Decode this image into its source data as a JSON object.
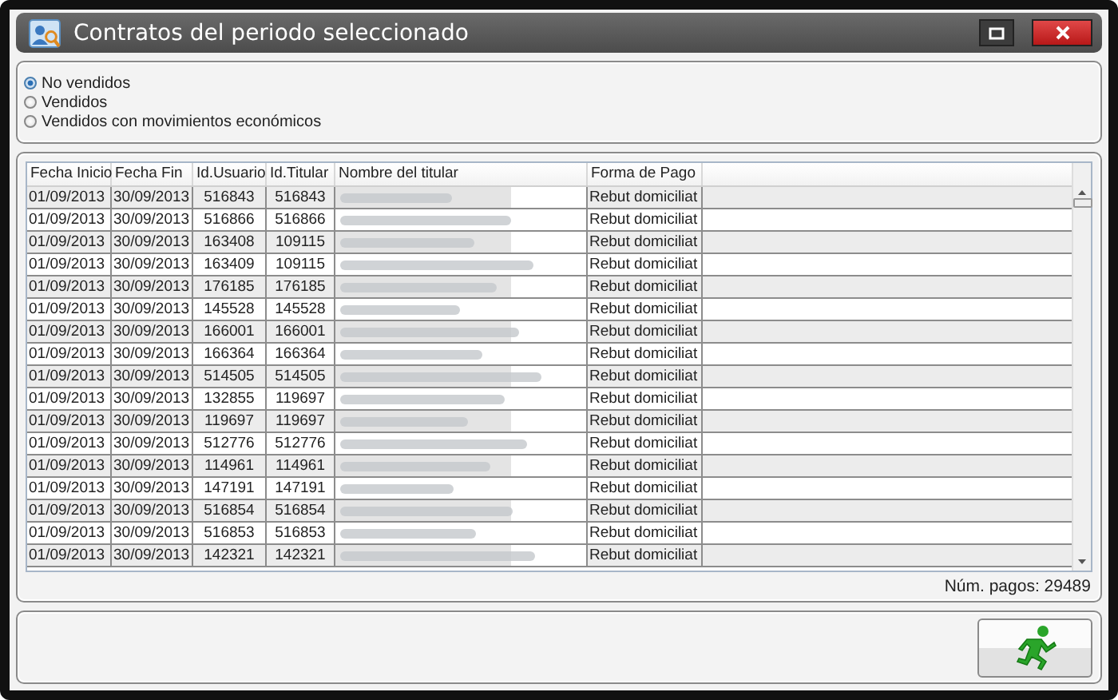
{
  "window": {
    "title": "Contratos del periodo seleccionado"
  },
  "filters": [
    {
      "label": "No vendidos",
      "selected": true
    },
    {
      "label": "Vendidos",
      "selected": false
    },
    {
      "label": "Vendidos con movimientos económicos",
      "selected": false
    }
  ],
  "table": {
    "columns": [
      "Fecha Inicio",
      "Fecha Fin",
      "Id.Usuario",
      "Id.Titular",
      "Nombre del titular",
      "Forma de Pago"
    ],
    "rows": [
      [
        "01/09/2013",
        "30/09/2013",
        "516843",
        "516843",
        "Rebut domiciliat"
      ],
      [
        "01/09/2013",
        "30/09/2013",
        "516866",
        "516866",
        "Rebut domiciliat"
      ],
      [
        "01/09/2013",
        "30/09/2013",
        "163408",
        "109115",
        "Rebut domiciliat"
      ],
      [
        "01/09/2013",
        "30/09/2013",
        "163409",
        "109115",
        "Rebut domiciliat"
      ],
      [
        "01/09/2013",
        "30/09/2013",
        "176185",
        "176185",
        "Rebut domiciliat"
      ],
      [
        "01/09/2013",
        "30/09/2013",
        "145528",
        "145528",
        "Rebut domiciliat"
      ],
      [
        "01/09/2013",
        "30/09/2013",
        "166001",
        "166001",
        "Rebut domiciliat"
      ],
      [
        "01/09/2013",
        "30/09/2013",
        "166364",
        "166364",
        "Rebut domiciliat"
      ],
      [
        "01/09/2013",
        "30/09/2013",
        "514505",
        "514505",
        "Rebut domiciliat"
      ],
      [
        "01/09/2013",
        "30/09/2013",
        "132855",
        "119697",
        "Rebut domiciliat"
      ],
      [
        "01/09/2013",
        "30/09/2013",
        "119697",
        "119697",
        "Rebut domiciliat"
      ],
      [
        "01/09/2013",
        "30/09/2013",
        "512776",
        "512776",
        "Rebut domiciliat"
      ],
      [
        "01/09/2013",
        "30/09/2013",
        "114961",
        "114961",
        "Rebut domiciliat"
      ],
      [
        "01/09/2013",
        "30/09/2013",
        "147191",
        "147191",
        "Rebut domiciliat"
      ],
      [
        "01/09/2013",
        "30/09/2013",
        "516854",
        "516854",
        "Rebut domiciliat"
      ],
      [
        "01/09/2013",
        "30/09/2013",
        "516853",
        "516853",
        "Rebut domiciliat"
      ],
      [
        "01/09/2013",
        "30/09/2013",
        "142321",
        "142321",
        "Rebut domiciliat"
      ]
    ]
  },
  "status": "Núm. pagos: 29489"
}
